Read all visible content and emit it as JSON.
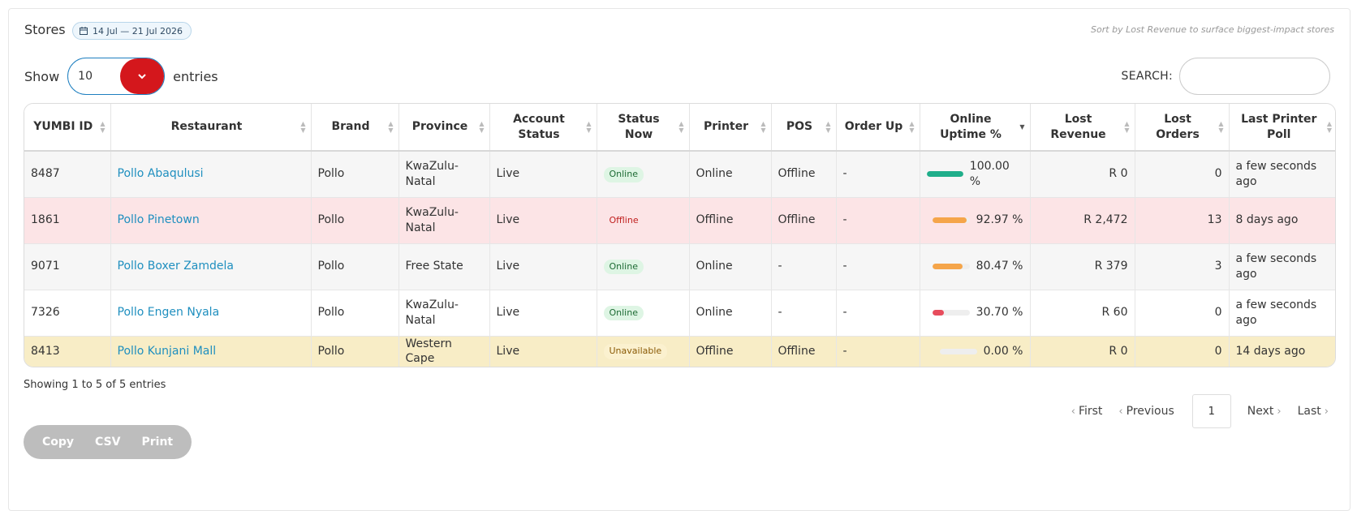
{
  "header": {
    "title": "Stores",
    "date_range": "14 Jul — 21 Jul 2026",
    "hint": "Sort by Lost Revenue to surface biggest-impact stores"
  },
  "length": {
    "show_label": "Show",
    "value": "10",
    "entries_label": "entries"
  },
  "search": {
    "label": "SEARCH:",
    "value": ""
  },
  "table": {
    "columns": [
      "YUMBI ID",
      "Restaurant",
      "Brand",
      "Province",
      "Account Status",
      "Status Now",
      "Printer",
      "POS",
      "Order Up",
      "Online Uptime %",
      "Lost Revenue",
      "Lost Orders",
      "Last Printer Poll"
    ],
    "sorted_column": "Online Uptime %",
    "sort_direction": "descending",
    "rows": [
      {
        "id": "8487",
        "restaurant": "Pollo Abaqulusi",
        "brand": "Pollo",
        "province": "KwaZulu-Natal",
        "account_status": "Live",
        "status_now": "Online",
        "printer": "Online",
        "pos": "Offline",
        "order_up": "-",
        "uptime": 100.0,
        "uptime_text": "100.00 %",
        "lost_revenue": "R 0",
        "lost_orders": "0",
        "last_poll": "a few seconds ago"
      },
      {
        "id": "1861",
        "restaurant": "Pollo Pinetown",
        "brand": "Pollo",
        "province": "KwaZulu-Natal",
        "account_status": "Live",
        "status_now": "Offline",
        "printer": "Offline",
        "pos": "Offline",
        "order_up": "-",
        "uptime": 92.97,
        "uptime_text": "92.97 %",
        "lost_revenue": "R 2,472",
        "lost_orders": "13",
        "last_poll": "8 days ago"
      },
      {
        "id": "9071",
        "restaurant": "Pollo Boxer Zamdela",
        "brand": "Pollo",
        "province": "Free State",
        "account_status": "Live",
        "status_now": "Online",
        "printer": "Online",
        "pos": "-",
        "order_up": "-",
        "uptime": 80.47,
        "uptime_text": "80.47 %",
        "lost_revenue": "R 379",
        "lost_orders": "3",
        "last_poll": "a few seconds ago"
      },
      {
        "id": "7326",
        "restaurant": "Pollo Engen Nyala",
        "brand": "Pollo",
        "province": "KwaZulu-Natal",
        "account_status": "Live",
        "status_now": "Online",
        "printer": "Online",
        "pos": "-",
        "order_up": "-",
        "uptime": 30.7,
        "uptime_text": "30.70 %",
        "lost_revenue": "R 60",
        "lost_orders": "0",
        "last_poll": "a few seconds ago"
      },
      {
        "id": "8413",
        "restaurant": "Pollo Kunjani Mall",
        "brand": "Pollo",
        "province": "Western Cape",
        "account_status": "Live",
        "status_now": "Unavailable",
        "printer": "Offline",
        "pos": "Offline",
        "order_up": "-",
        "uptime": 0.0,
        "uptime_text": "0.00 %",
        "lost_revenue": "R 0",
        "lost_orders": "0",
        "last_poll": "14 days ago"
      }
    ]
  },
  "info": "Showing 1 to 5 of 5 entries",
  "pagination": {
    "first": "First",
    "previous": "Previous",
    "current": "1",
    "next": "Next",
    "last": "Last"
  },
  "buttons": {
    "copy": "Copy",
    "csv": "CSV",
    "print": "Print"
  },
  "colors": {
    "accent_red": "#d4171c",
    "link": "#1f8fbf",
    "bar_green": "#1fae8a",
    "bar_orange": "#f5a54a",
    "bar_red": "#e74c5c",
    "row_offline": "#fce4e6",
    "row_unavailable": "#f8edc6"
  },
  "icons": {
    "date_badge": "calendar-icon",
    "select": "chevron-down-icon",
    "pager_prev": "chevron-left-icon",
    "pager_next": "chevron-right-icon"
  }
}
